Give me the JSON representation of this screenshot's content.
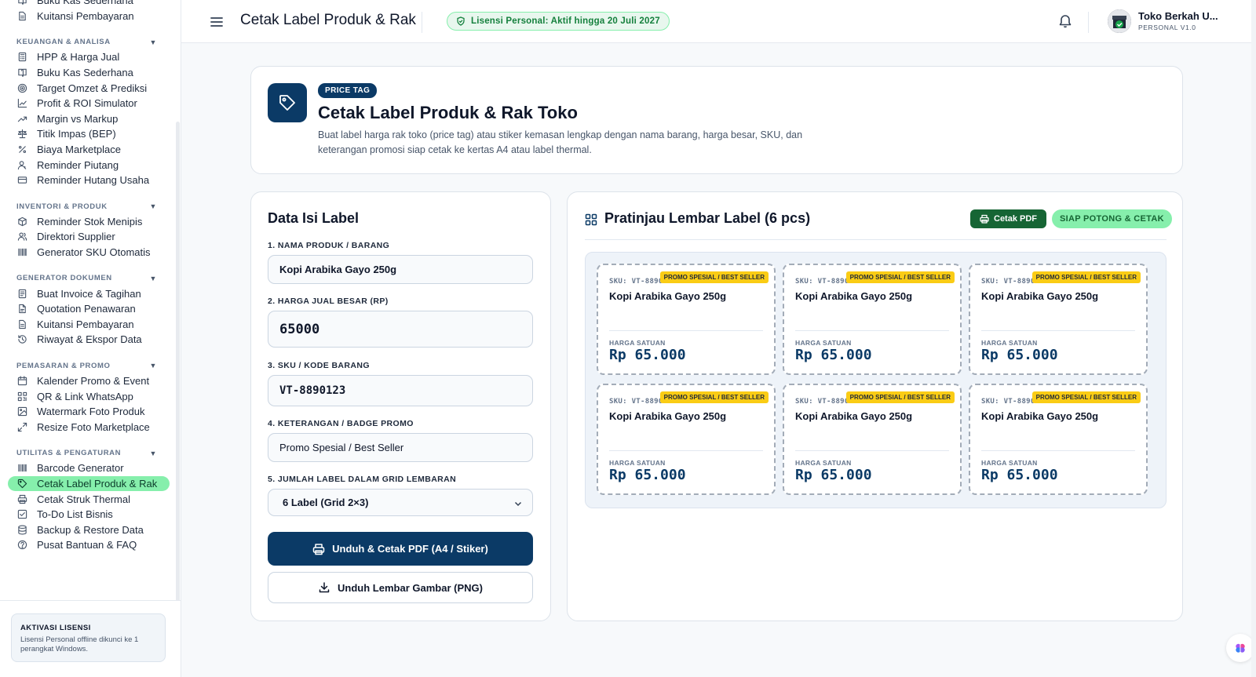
{
  "sidebar": {
    "top_items": [
      {
        "label": "Buku Kas Sederhana",
        "icon": "book-icon"
      },
      {
        "label": "Kuitansi Pembayaran",
        "icon": "receipt-icon"
      }
    ],
    "groups": [
      {
        "title": "KEUANGAN & ANALISA",
        "items": [
          {
            "label": "HPP & Harga Jual",
            "icon": "calculator-icon"
          },
          {
            "label": "Buku Kas Sederhana",
            "icon": "book-icon"
          },
          {
            "label": "Target Omzet & Prediksi",
            "icon": "target-icon"
          },
          {
            "label": "Profit & ROI Simulator",
            "icon": "line-chart-icon"
          },
          {
            "label": "Margin vs Markup",
            "icon": "trending-up-icon"
          },
          {
            "label": "Titik Impas (BEP)",
            "icon": "scale-icon"
          },
          {
            "label": "Biaya Marketplace",
            "icon": "percent-icon"
          },
          {
            "label": "Reminder Piutang",
            "icon": "user-clock-icon"
          },
          {
            "label": "Reminder Hutang Usaha",
            "icon": "card-icon"
          }
        ]
      },
      {
        "title": "INVENTORI & PRODUK",
        "items": [
          {
            "label": "Reminder Stok Menipis",
            "icon": "package-icon"
          },
          {
            "label": "Direktori Supplier",
            "icon": "users-icon"
          },
          {
            "label": "Generator SKU Otomatis",
            "icon": "barcode-icon"
          }
        ]
      },
      {
        "title": "GENERATOR DOKUMEN",
        "items": [
          {
            "label": "Buat Invoice & Tagihan",
            "icon": "invoice-icon"
          },
          {
            "label": "Quotation Penawaran",
            "icon": "document-icon"
          },
          {
            "label": "Kuitansi Pembayaran",
            "icon": "receipt-icon"
          },
          {
            "label": "Riwayat & Ekspor Data",
            "icon": "history-icon"
          }
        ]
      },
      {
        "title": "PEMASARAN & PROMO",
        "items": [
          {
            "label": "Kalender Promo & Event",
            "icon": "calendar-icon"
          },
          {
            "label": "QR & Link WhatsApp",
            "icon": "qr-icon"
          },
          {
            "label": "Watermark Foto Produk",
            "icon": "image-icon"
          },
          {
            "label": "Resize Foto Marketplace",
            "icon": "resize-icon"
          }
        ]
      },
      {
        "title": "UTILITAS & PENGATURAN",
        "items": [
          {
            "label": "Barcode Generator",
            "icon": "barcode-icon"
          },
          {
            "label": "Cetak Label Produk & Rak",
            "icon": "tag-icon",
            "active": true
          },
          {
            "label": "Cetak Struk Thermal",
            "icon": "printer-icon"
          },
          {
            "label": "To-Do List Bisnis",
            "icon": "checkbox-icon"
          },
          {
            "label": "Backup & Restore Data",
            "icon": "database-icon"
          },
          {
            "label": "Pusat Bantuan & FAQ",
            "icon": "help-icon"
          }
        ]
      }
    ],
    "license_box": {
      "title": "AKTIVASI LISENSI",
      "desc": "Lisensi Personal offline dikunci ke 1 perangkat Windows."
    }
  },
  "topbar": {
    "title": "Cetak Label Produk & Rak",
    "license_badge": "Lisensi Personal: Aktif hingga 20 Juli 2027",
    "user_name": "Toko Berkah U...",
    "user_sub": "PERSONAL V1.0"
  },
  "hero": {
    "tag": "PRICE TAG",
    "title": "Cetak Label Produk & Rak Toko",
    "desc": "Buat label harga rak toko (price tag) atau stiker kemasan lengkap dengan nama barang, harga besar, SKU, dan keterangan promosi siap cetak ke kertas A4 atau label thermal."
  },
  "form": {
    "title": "Data Isi Label",
    "name_label": "1. NAMA PRODUK / BARANG",
    "name_value": "Kopi Arabika Gayo 250g",
    "price_label": "2. HARGA JUAL BESAR (RP)",
    "price_value": "65000",
    "sku_label": "3. SKU / KODE BARANG",
    "sku_value": "VT-8890123",
    "promo_label": "4. KETERANGAN / BADGE PROMO",
    "promo_value": "Promo Spesial / Best Seller",
    "grid_label": "5. JUMLAH LABEL DALAM GRID LEMBARAN",
    "grid_value": "6 Label (Grid 2×3)",
    "print_button": "Unduh & Cetak PDF (A4 / Stiker)",
    "png_button": "Unduh Lembar Gambar (PNG)"
  },
  "preview": {
    "title": "Pratinjau Lembar Label (6 pcs)",
    "pdf_button": "Cetak PDF",
    "status": "SIAP POTONG & CETAK",
    "labels": [
      {
        "badge": "PROMO SPESIAL / BEST SELLER",
        "sku": "SKU: VT-8890123",
        "name": "Kopi Arabika Gayo 250g",
        "price_label": "HARGA SATUAN",
        "price": "Rp 65.000"
      },
      {
        "badge": "PROMO SPESIAL / BEST SELLER",
        "sku": "SKU: VT-8890123",
        "name": "Kopi Arabika Gayo 250g",
        "price_label": "HARGA SATUAN",
        "price": "Rp 65.000"
      },
      {
        "badge": "PROMO SPESIAL / BEST SELLER",
        "sku": "SKU: VT-8890123",
        "name": "Kopi Arabika Gayo 250g",
        "price_label": "HARGA SATUAN",
        "price": "Rp 65.000"
      },
      {
        "badge": "PROMO SPESIAL / BEST SELLER",
        "sku": "SKU: VT-8890123",
        "name": "Kopi Arabika Gayo 250g",
        "price_label": "HARGA SATUAN",
        "price": "Rp 65.000"
      },
      {
        "badge": "PROMO SPESIAL / BEST SELLER",
        "sku": "SKU: VT-8890123",
        "name": "Kopi Arabika Gayo 250g",
        "price_label": "HARGA SATUAN",
        "price": "Rp 65.000"
      },
      {
        "badge": "PROMO SPESIAL / BEST SELLER",
        "sku": "SKU: VT-8890123",
        "name": "Kopi Arabika Gayo 250g",
        "price_label": "HARGA SATUAN",
        "price": "Rp 65.000"
      }
    ]
  },
  "colors": {
    "primary": "#0b3a66",
    "accent_green": "#86efac",
    "promo_yellow": "#facc15"
  }
}
